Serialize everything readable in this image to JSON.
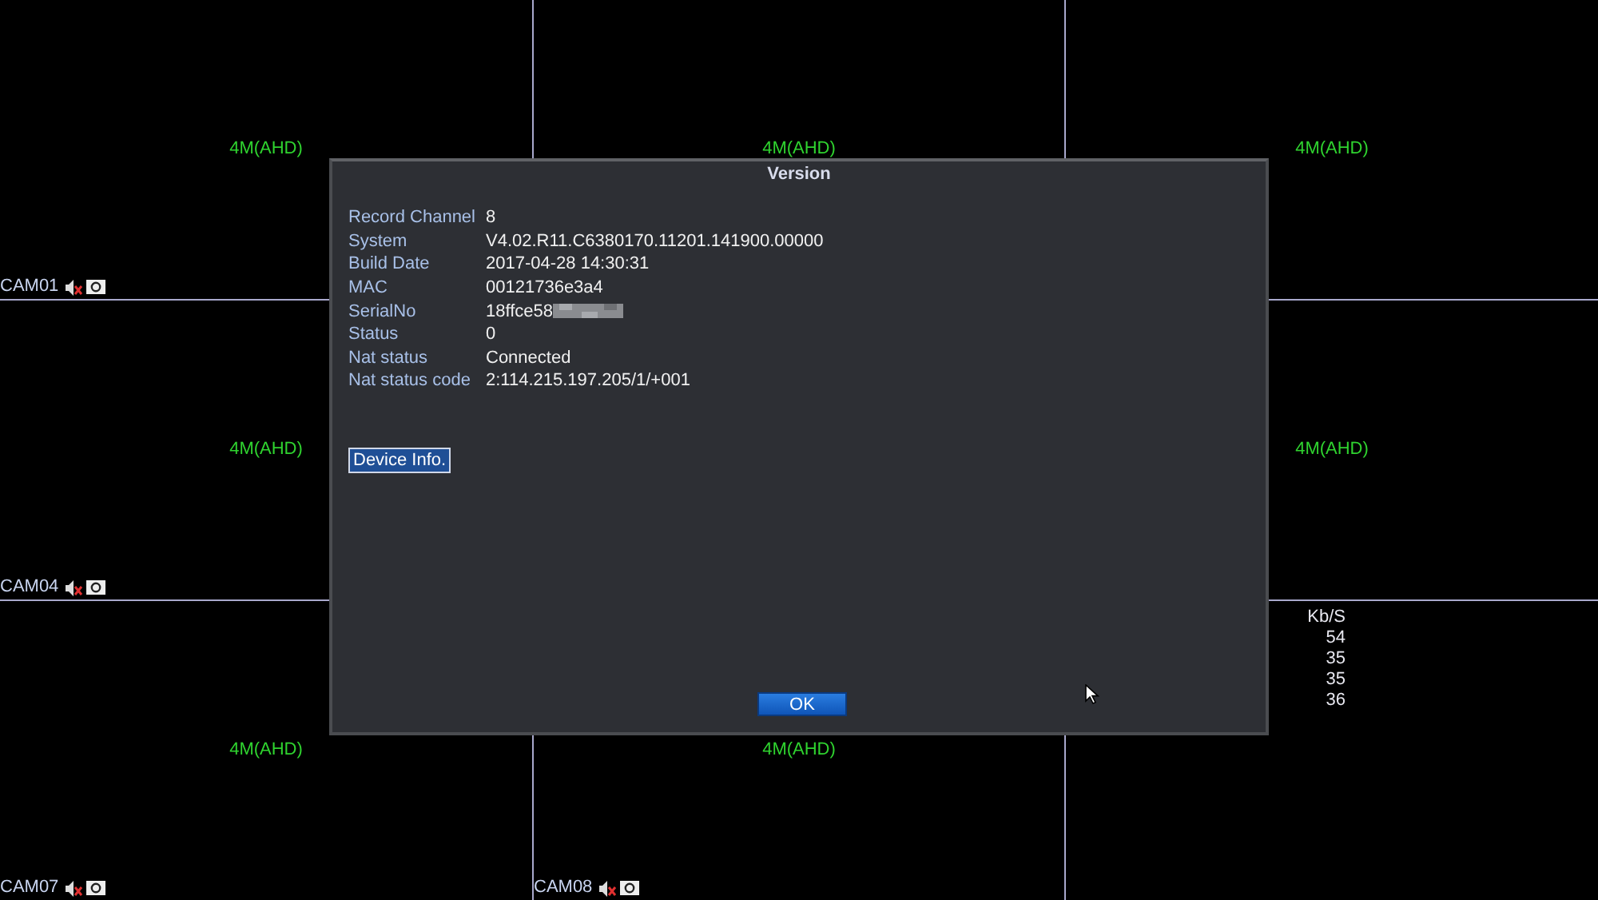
{
  "tiles": [
    {
      "resolution": "4M(AHD)",
      "name": "CAM01"
    },
    {
      "resolution": "4M(AHD)"
    },
    {
      "resolution": "4M(AHD)"
    },
    {
      "resolution": "4M(AHD)",
      "name": "CAM04"
    },
    {
      "covered": true
    },
    {
      "resolution": "4M(AHD)"
    },
    {
      "resolution": "4M(AHD)",
      "name": "CAM07"
    },
    {
      "resolution": "4M(AHD)",
      "name": "CAM08"
    },
    {
      "bitrate": {
        "header": "Kb/S",
        "values": [
          "54",
          "35",
          "35",
          "36"
        ]
      }
    }
  ],
  "dialog": {
    "title": "Version",
    "fields": [
      {
        "label": "Record Channel",
        "value": "8"
      },
      {
        "label": "System",
        "value": "V4.02.R11.C6380170.11201.141900.00000"
      },
      {
        "label": "Build Date",
        "value": "2017-04-28 14:30:31"
      },
      {
        "label": "MAC",
        "value": "00121736e3a4"
      },
      {
        "label": "SerialNo",
        "value": "18ffce58",
        "redacted": true
      },
      {
        "label": "Status",
        "value": "0"
      },
      {
        "label": "Nat status",
        "value": "Connected"
      },
      {
        "label": "Nat status code",
        "value": "2:114.215.197.205/1/+001"
      }
    ],
    "device_info_button": "Device Info.",
    "ok_button": "OK"
  }
}
